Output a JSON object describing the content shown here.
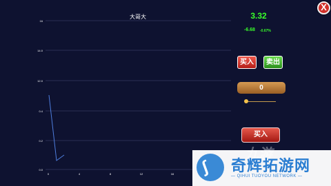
{
  "game": {
    "stock_name": "大哥大",
    "price": "3.32",
    "change_abs": "-6.68",
    "change_pct": "-0.67%",
    "buy_label": "买入",
    "sell_label": "卖出",
    "quantity": "0",
    "quantity_slider_value": 0,
    "big_buy_label": "买入",
    "close_label": "X"
  },
  "watermark": {
    "text": "奇辉拓游网",
    "subtext": "— QIHUI TUOYOU NETWORK —",
    "top_text": "九游"
  },
  "chart_data": {
    "type": "line",
    "title": "大哥大",
    "xlabel": "",
    "ylabel": "",
    "x": [
      0,
      1,
      2
    ],
    "series": [
      {
        "values": [
          9.8,
          0.7,
          1.1
        ]
      }
    ],
    "xlim": [
      0,
      15
    ],
    "ylim": [
      0,
      16
    ],
    "xticks": [
      "0",
      "4",
      "8",
      "12",
      "16"
    ],
    "yticks": [
      "0.0",
      "0.2",
      "0.4",
      "12.0",
      "14.0",
      "16"
    ],
    "grid": true,
    "colors": {
      "line": "#4f7fe0",
      "grid": "#2a2f55",
      "text": "#ffffff",
      "positive": "#39ff2a"
    }
  }
}
